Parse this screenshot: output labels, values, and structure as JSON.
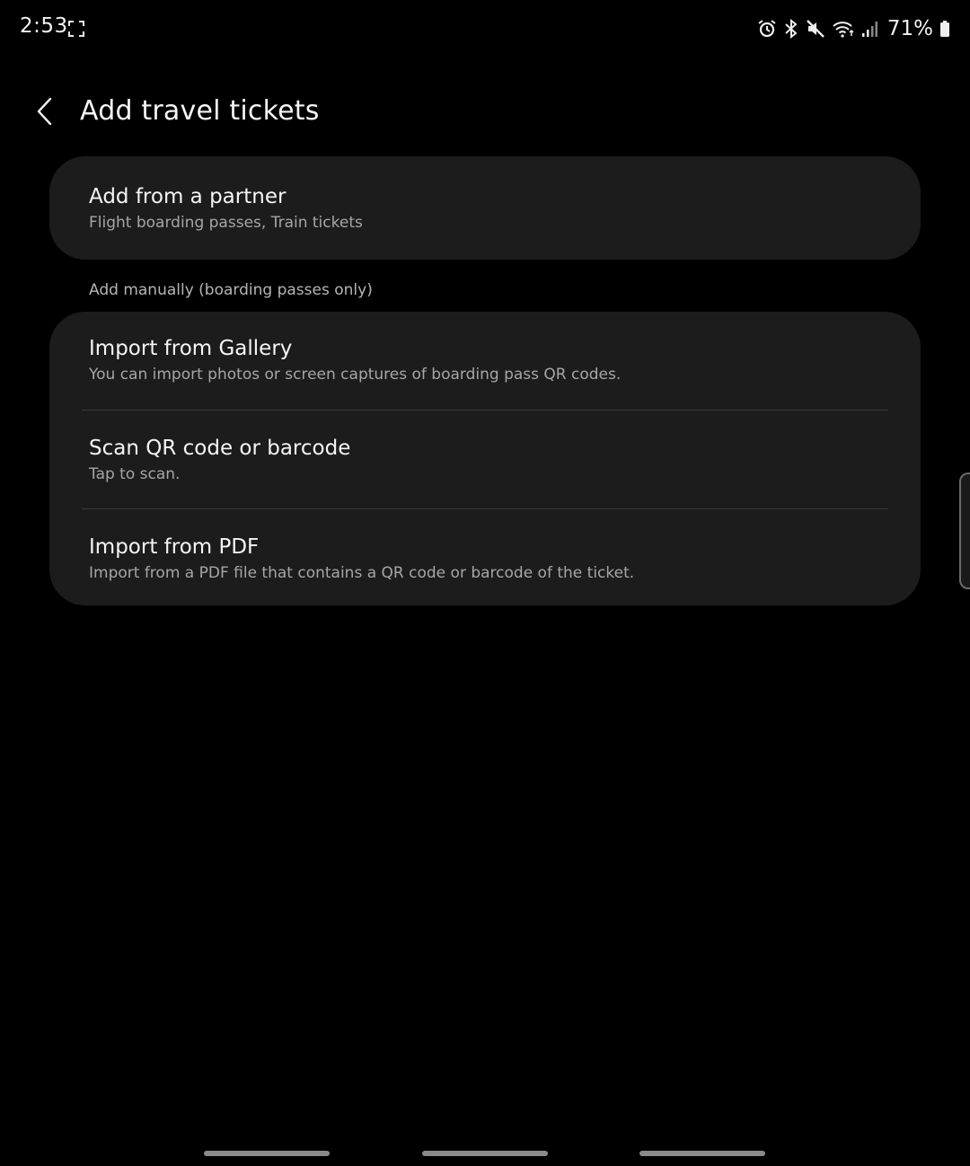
{
  "status_bar": {
    "time": "2:53",
    "battery": "71%",
    "icons": [
      "screenshot-icon",
      "alarm-icon",
      "bluetooth-icon",
      "mute-icon",
      "wifi-icon",
      "signal-icon",
      "battery-icon"
    ]
  },
  "header": {
    "title": "Add travel tickets",
    "back_icon": "chevron-left-icon"
  },
  "partner_card": {
    "title": "Add from a partner",
    "subtitle": "Flight boarding passes, Train tickets"
  },
  "manual_section": {
    "label": "Add manually (boarding passes only)",
    "items": [
      {
        "title": "Import from Gallery",
        "subtitle": "You can import photos or screen captures of boarding pass QR codes."
      },
      {
        "title": "Scan QR code or barcode",
        "subtitle": "Tap to scan."
      },
      {
        "title": "Import from PDF",
        "subtitle": "Import from a PDF file that contains a QR code or barcode of the ticket."
      }
    ]
  },
  "colors": {
    "background": "#000000",
    "card": "#1c1c1c",
    "divider": "#3a3a3a",
    "subtitle": "#a6a6a6"
  }
}
